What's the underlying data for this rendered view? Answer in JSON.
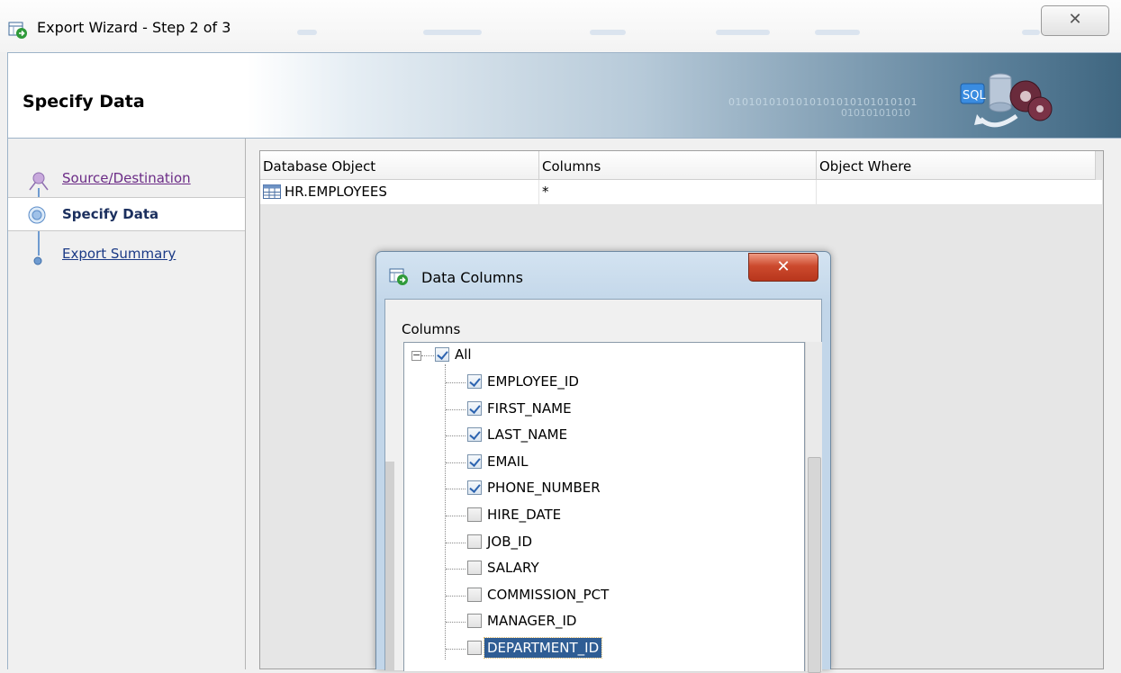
{
  "window": {
    "title": "Export Wizard - Step 2 of 3",
    "close_glyph": "✕"
  },
  "banner": {
    "title": "Specify Data",
    "binary_line1": "0101010101010101010101010101",
    "binary_line2": "01010101010",
    "graphic_label": "SQL"
  },
  "nav": {
    "items": [
      {
        "label": "Source/Destination",
        "state": "visited"
      },
      {
        "label": "Specify Data",
        "state": "active"
      },
      {
        "label": "Export Summary",
        "state": "link"
      }
    ]
  },
  "grid": {
    "headers": [
      "Database Object",
      "Columns",
      "Object Where"
    ],
    "row": {
      "object": "HR.EMPLOYEES",
      "columns": "*",
      "where": ""
    }
  },
  "dialog": {
    "title": "Data Columns",
    "close_glyph": "✕",
    "columns_label": "Columns",
    "root": {
      "label": "All",
      "checked": true,
      "expanded": true,
      "expander_glyph": "−"
    },
    "items": [
      {
        "label": "EMPLOYEE_ID",
        "checked": true
      },
      {
        "label": "FIRST_NAME",
        "checked": true
      },
      {
        "label": "LAST_NAME",
        "checked": true
      },
      {
        "label": "EMAIL",
        "checked": true
      },
      {
        "label": "PHONE_NUMBER",
        "checked": true
      },
      {
        "label": "HIRE_DATE",
        "checked": false
      },
      {
        "label": "JOB_ID",
        "checked": false
      },
      {
        "label": "SALARY",
        "checked": false
      },
      {
        "label": "COMMISSION_PCT",
        "checked": false
      },
      {
        "label": "MANAGER_ID",
        "checked": false
      },
      {
        "label": "DEPARTMENT_ID",
        "checked": false,
        "selected": true
      }
    ]
  },
  "colors": {
    "selection": "#2f5d94",
    "check": "#2d64b0",
    "link": "#1b3a86",
    "visited_link": "#6b2b86"
  }
}
